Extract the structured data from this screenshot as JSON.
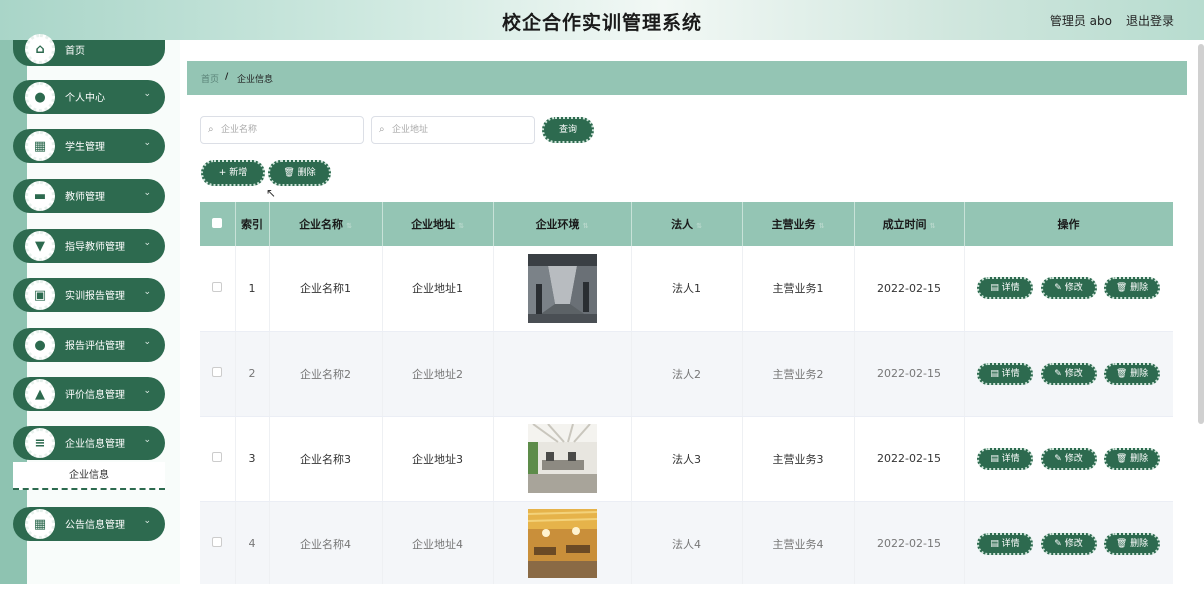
{
  "header": {
    "title": "校企合作实训管理系统",
    "user": "管理员 abo",
    "logout": "退出登录"
  },
  "sidebar": {
    "items": [
      {
        "label": "首页",
        "icon": "home-icon",
        "glyph": "⌂"
      },
      {
        "label": "个人中心",
        "icon": "user-icon",
        "glyph": "●"
      },
      {
        "label": "学生管理",
        "icon": "grid-icon",
        "glyph": "▦"
      },
      {
        "label": "教师管理",
        "icon": "briefcase-icon",
        "glyph": "▬"
      },
      {
        "label": "指导教师管理",
        "icon": "filter-icon",
        "glyph": "▼"
      },
      {
        "label": "实训报告管理",
        "icon": "report-icon",
        "glyph": "▣"
      },
      {
        "label": "报告评估管理",
        "icon": "bulb-icon",
        "glyph": "●"
      },
      {
        "label": "评价信息管理",
        "icon": "user-check-icon",
        "glyph": "▲"
      },
      {
        "label": "企业信息管理",
        "icon": "sliders-icon",
        "glyph": "≡"
      },
      {
        "label": "公告信息管理",
        "icon": "grid-icon",
        "glyph": "▦"
      }
    ],
    "submenu_item": "企业信息",
    "chevron": "⌄"
  },
  "breadcrumb": {
    "home": "首页",
    "separator": "/",
    "current": "企业信息"
  },
  "search": {
    "name_placeholder": "企业名称",
    "address_placeholder": "企业地址",
    "search_icon": "⌕",
    "query_button": "查询"
  },
  "toolbar": {
    "add_button": "+ 新增",
    "delete_button": "🗑 删除"
  },
  "table": {
    "columns": [
      "索引",
      "企业名称",
      "企业地址",
      "企业环境",
      "法人",
      "主营业务",
      "成立时间",
      "操作"
    ],
    "sort_glyph": "⇅",
    "rows": [
      {
        "index": "1",
        "name": "企业名称1",
        "address": "企业地址1",
        "image": "office-corridor",
        "legal": "法人1",
        "business": "主营业务1",
        "date": "2022-02-15"
      },
      {
        "index": "2",
        "name": "企业名称2",
        "address": "企业地址2",
        "image": "",
        "legal": "法人2",
        "business": "主营业务2",
        "date": "2022-02-15"
      },
      {
        "index": "3",
        "name": "企业名称3",
        "address": "企业地址3",
        "image": "open-office",
        "legal": "法人3",
        "business": "主营业务3",
        "date": "2022-02-15"
      },
      {
        "index": "4",
        "name": "企业名称4",
        "address": "企业地址4",
        "image": "warm-office",
        "legal": "法人4",
        "business": "主营业务4",
        "date": "2022-02-15"
      }
    ],
    "actions": {
      "detail": "▤ 详情",
      "edit": "✎ 修改",
      "delete": "🗑 删除"
    }
  },
  "colors": {
    "primary": "#2d6a4f",
    "header_green": "#94c5b4",
    "strip": "#8ec3b1"
  }
}
